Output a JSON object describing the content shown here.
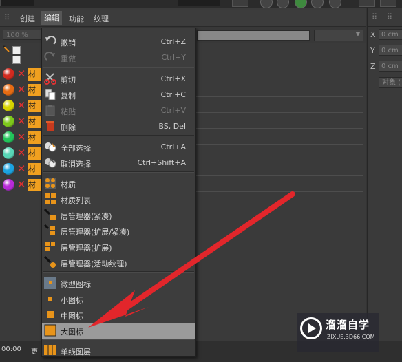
{
  "menubar": {
    "grip": "⠿",
    "items": [
      "创建",
      "编辑",
      "功能",
      "纹理"
    ],
    "active_index": 1
  },
  "toolbar": {
    "zoom": "100 %"
  },
  "materials": {
    "label_prefix": "材",
    "colors": [
      "#d22a1f",
      "#e66b12",
      "#d7d400",
      "#7dc81a",
      "#22c45a",
      "#58d6b6",
      "#1ba3e0",
      "#b82ad8"
    ]
  },
  "right_panel": {
    "grip": "⠿",
    "coords": [
      {
        "axis": "X",
        "value": "0 cm"
      },
      {
        "axis": "Y",
        "value": "0 cm"
      },
      {
        "axis": "Z",
        "value": "0 cm"
      }
    ],
    "object_button": "对象 ("
  },
  "bottom_bar": {
    "time": "00:00",
    "more": "更"
  },
  "menu": {
    "groups": [
      [
        {
          "id": "undo",
          "label": "撤销",
          "shortcut": "Ctrl+Z",
          "icon": "undo-icon",
          "enabled": true
        },
        {
          "id": "redo",
          "label": "重做",
          "shortcut": "Ctrl+Y",
          "icon": "redo-icon",
          "enabled": false
        }
      ],
      [
        {
          "id": "cut",
          "label": "剪切",
          "shortcut": "Ctrl+X",
          "icon": "scissors-icon",
          "enabled": true
        },
        {
          "id": "copy",
          "label": "复制",
          "shortcut": "Ctrl+C",
          "icon": "copy-icon",
          "enabled": true
        },
        {
          "id": "paste",
          "label": "粘贴",
          "shortcut": "Ctrl+V",
          "icon": "paste-icon",
          "enabled": false
        },
        {
          "id": "delete",
          "label": "删除",
          "shortcut": "BS, Del",
          "icon": "trash-icon",
          "enabled": true
        }
      ],
      [
        {
          "id": "select-all",
          "label": "全部选择",
          "shortcut": "Ctrl+A",
          "icon": "select-all-icon",
          "enabled": true
        },
        {
          "id": "deselect",
          "label": "取消选择",
          "shortcut": "Ctrl+Shift+A",
          "icon": "deselect-icon",
          "enabled": true
        }
      ],
      [
        {
          "id": "material",
          "label": "材质",
          "shortcut": "",
          "icon": "material-grid-icon",
          "enabled": true
        },
        {
          "id": "material-list",
          "label": "材质列表",
          "shortcut": "",
          "icon": "material-list-icon",
          "enabled": true
        },
        {
          "id": "layer-compact",
          "label": "层管理器(紧凑)",
          "shortcut": "",
          "icon": "layer-compact-icon",
          "enabled": true
        },
        {
          "id": "layer-expand-compact",
          "label": "层管理器(扩展/紧凑)",
          "shortcut": "",
          "icon": "layer-expand-compact-icon",
          "enabled": true
        },
        {
          "id": "layer-expand",
          "label": "层管理器(扩展)",
          "shortcut": "",
          "icon": "layer-expand-icon",
          "enabled": true
        },
        {
          "id": "layer-active-texture",
          "label": "层管理器(活动纹理)",
          "shortcut": "",
          "icon": "layer-active-texture-icon",
          "enabled": true
        }
      ],
      [
        {
          "id": "tiny-icons",
          "label": "微型图标",
          "shortcut": "",
          "icon": "tiny-icon-size-icon",
          "enabled": true
        },
        {
          "id": "small-icons",
          "label": "小图标",
          "shortcut": "",
          "icon": "small-icon-size-icon",
          "enabled": true
        },
        {
          "id": "medium-icons",
          "label": "中图标",
          "shortcut": "",
          "icon": "medium-icon-size-icon",
          "enabled": true
        },
        {
          "id": "large-icons",
          "label": "大图标",
          "shortcut": "",
          "icon": "large-icon-size-icon",
          "enabled": true,
          "highlighted": true
        }
      ],
      [
        {
          "id": "single-line-layer",
          "label": "单线图层",
          "shortcut": "",
          "icon": "single-line-layer-icon",
          "enabled": true
        }
      ]
    ]
  },
  "watermark": {
    "title": "溜溜自学",
    "url": "ZIXUE.3D66.COM"
  },
  "colors": {
    "annotation_arrow": "#e2262b",
    "material_tag": "#f0a020",
    "highlight": "#9b9b9b"
  }
}
